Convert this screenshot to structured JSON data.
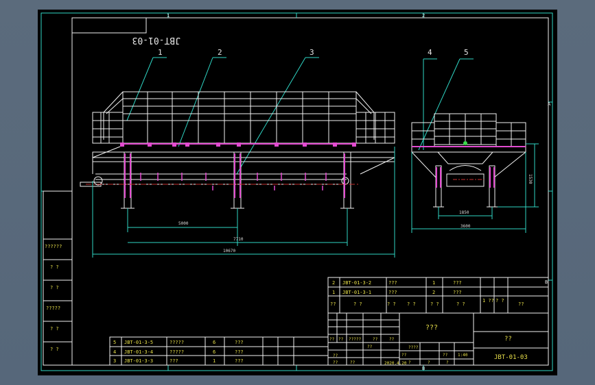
{
  "drawing_number": "JBT-01-03",
  "part_callouts": [
    "1",
    "2",
    "3",
    "4",
    "5"
  ],
  "zone_markers": {
    "top": [
      "1",
      "2"
    ],
    "bottom": [
      "B"
    ],
    "right": [
      "A",
      "B"
    ]
  },
  "dimensions": {
    "front_span_inner": "5000",
    "front_span_outer": "7710",
    "front_overall": "10670",
    "side_inner": "1850",
    "side_outer": "3600",
    "side_height": "1530"
  },
  "left_margin_labels": [
    "??????",
    "? ?",
    "? ?",
    "?????",
    "? ?",
    "? ?"
  ],
  "parts_list_upper": [
    {
      "no": "2",
      "code": "JBT-01-3-2",
      "name": "???",
      "qty": "1",
      "material": "???"
    },
    {
      "no": "1",
      "code": "JBT-01-3-1",
      "name": "???",
      "qty": "2",
      "material": "???"
    }
  ],
  "parts_list_upper_header": [
    "??",
    "? ?",
    "? ?",
    "? ?",
    "? ?",
    "? ?",
    "1 ??",
    "? ?",
    "??"
  ],
  "parts_list_lower": [
    {
      "no": "5",
      "code": "JBT-01-3-5",
      "name": "?????",
      "qty": "6",
      "material": "???"
    },
    {
      "no": "4",
      "code": "JBT-01-3-4",
      "name": "?????",
      "qty": "6",
      "material": "???"
    },
    {
      "no": "3",
      "code": "JBT-01-3-3",
      "name": "???",
      "qty": "1",
      "material": "???"
    }
  ],
  "title_block": {
    "title": "???",
    "company": "??",
    "drawing_no": "JBT-01-03",
    "date": "2020.4.20",
    "scale": "1:40",
    "small_labels": [
      "??",
      "??",
      "?????",
      "??",
      "??",
      "??",
      "??",
      "????",
      "??",
      "??",
      "??",
      "??",
      "?",
      "?",
      "?"
    ]
  },
  "colors": {
    "frame": "#2fd7c6",
    "structure": "#f2f2f2",
    "members": "#e24bd0",
    "dims": "#31d6c4",
    "centerline": "#c93030",
    "text_table": "#e8e04a",
    "leaders": "#2fd7c6"
  }
}
